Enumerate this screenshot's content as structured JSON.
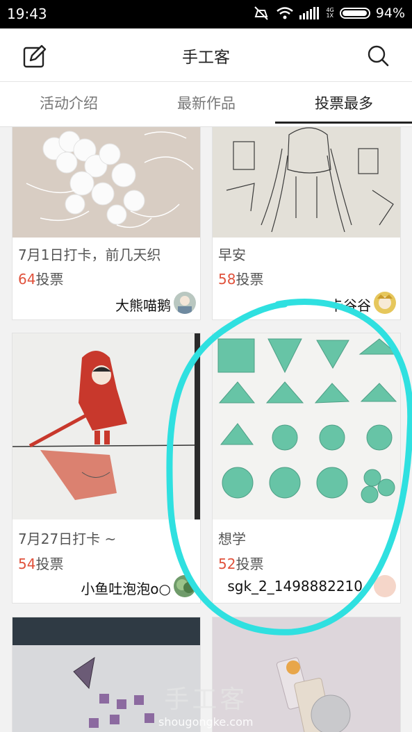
{
  "status": {
    "time": "19:43",
    "net": [
      "4G",
      "1X"
    ],
    "battery": "94%"
  },
  "app": {
    "title": "手工客"
  },
  "tabs": [
    {
      "label": "活动介绍"
    },
    {
      "label": "最新作品"
    },
    {
      "label": "投票最多"
    }
  ],
  "cards": [
    {
      "title": "7月1日打卡，前几天织",
      "votes": "64",
      "votes_suffix": "投票",
      "author": "大熊喵鹅"
    },
    {
      "title": "早安",
      "votes": "58",
      "votes_suffix": "投票",
      "author": "卡谷谷"
    },
    {
      "title": "7月27日打卡 ~",
      "votes": "54",
      "votes_suffix": "投票",
      "author": "小鱼吐泡泡o○"
    },
    {
      "title": "想学",
      "votes": "52",
      "votes_suffix": "投票",
      "author": "sgk_2_1498882210"
    }
  ],
  "watermark": {
    "logo": "手工客",
    "url": "shougongke.com"
  },
  "colors": {
    "accent": "#e0523c",
    "annotation": "#2fe0e0"
  }
}
